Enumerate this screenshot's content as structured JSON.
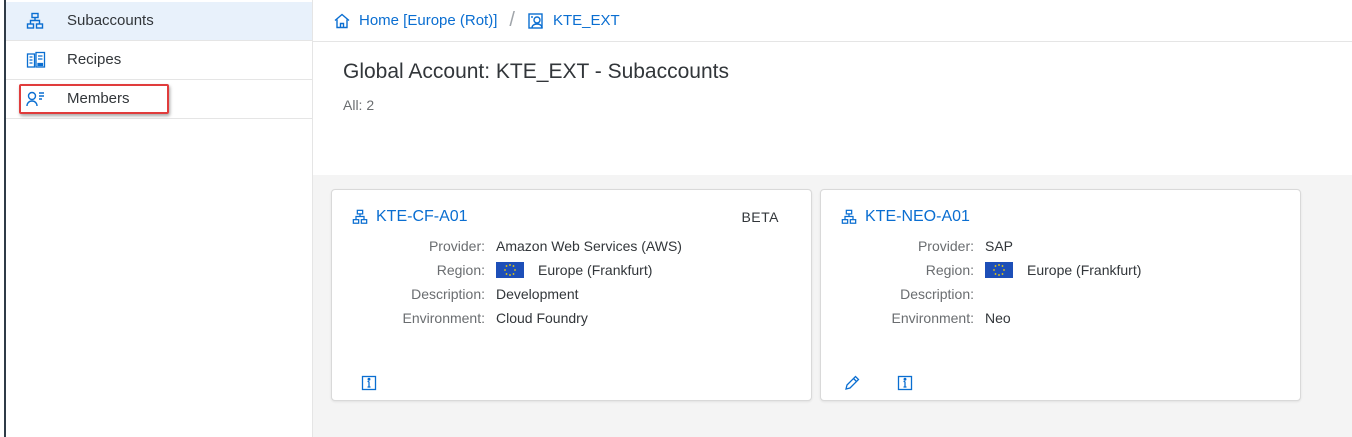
{
  "sidebar": {
    "items": [
      {
        "label": "Subaccounts",
        "icon": "hierarchy-icon",
        "selected": true
      },
      {
        "label": "Recipes",
        "icon": "recipes-icon",
        "selected": false
      },
      {
        "label": "Members",
        "icon": "members-icon",
        "selected": false
      }
    ]
  },
  "breadcrumb": {
    "home_label": "Home [Europe (Rot)]",
    "separator": "/",
    "current_label": "KTE_EXT"
  },
  "header": {
    "title": "Global Account: KTE_EXT - Subaccounts",
    "count": "All: 2"
  },
  "labels": {
    "provider": "Provider:",
    "region": "Region:",
    "description": "Description:",
    "environment": "Environment:"
  },
  "cards": [
    {
      "name": "KTE-CF-A01",
      "badge": "BETA",
      "provider": "Amazon Web Services (AWS)",
      "region": "Europe (Frankfurt)",
      "description": "Development",
      "environment": "Cloud Foundry"
    },
    {
      "name": "KTE-NEO-A01",
      "badge": "",
      "provider": "SAP",
      "region": "Europe (Frankfurt)",
      "description": "",
      "environment": "Neo"
    }
  ],
  "colors": {
    "accent": "#0a6ed1",
    "highlight": "#e03c3c",
    "selected_bg": "#e8f1fb"
  }
}
